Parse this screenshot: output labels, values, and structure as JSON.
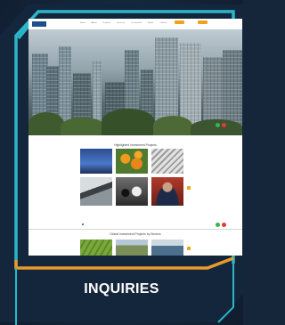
{
  "screenshot": {
    "nav_items": [
      "Home",
      "About",
      "Projects",
      "Services",
      "Investment",
      "Media",
      "Contact"
    ],
    "section1_title": "Highlighted Investment Projects",
    "section2_title": "Global Investment Projects by Sectors"
  },
  "cta": {
    "label": "INQUIRIES"
  },
  "colors": {
    "frame_teal": "#2bb6c9",
    "frame_orange": "#e89a2c",
    "cta_accent": "#f0a21b",
    "background": "#15253a"
  }
}
